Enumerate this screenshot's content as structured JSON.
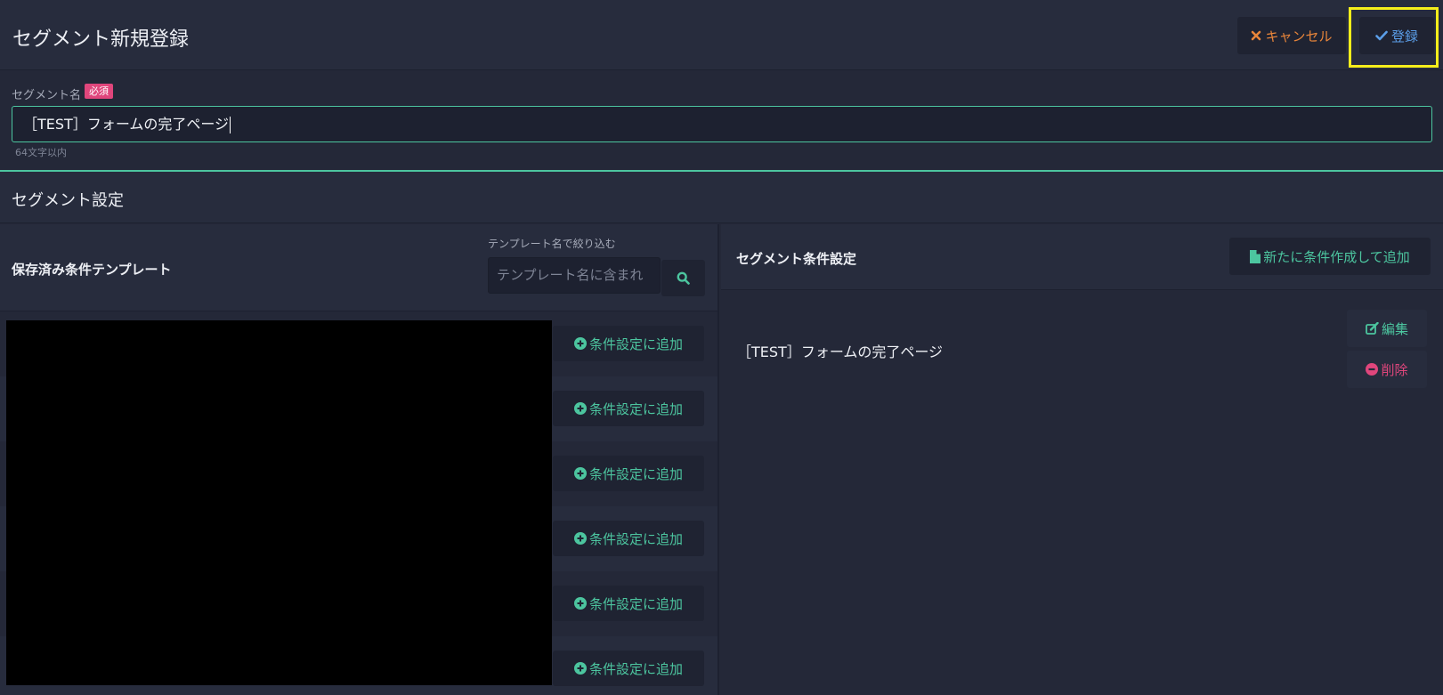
{
  "header": {
    "title": "セグメント新規登録",
    "cancel_label": "キャンセル",
    "register_label": "登録"
  },
  "segment_name": {
    "label": "セグメント名",
    "required_badge": "必須",
    "value": "［TEST］フォームの完了ページ",
    "hint": "64文字以内"
  },
  "segment_settings": {
    "title": "セグメント設定"
  },
  "templates": {
    "title": "保存済み条件テンプレート",
    "filter_label": "テンプレート名で絞り込む",
    "filter_placeholder": "テンプレート名に含まれ",
    "add_buttons": [
      "条件設定に追加",
      "条件設定に追加",
      "条件設定に追加",
      "条件設定に追加",
      "条件設定に追加",
      "条件設定に追加"
    ]
  },
  "conditions": {
    "title": "セグメント条件設定",
    "new_button_label": "新たに条件作成して追加",
    "item_label": "［TEST］フォームの完了ページ",
    "edit_label": "編集",
    "delete_label": "削除"
  },
  "colors": {
    "accent_green": "#4cc59f",
    "cancel_orange": "#e8853a",
    "register_blue": "#5b9ee8",
    "danger_pink": "#e0467c",
    "highlight_yellow": "#f5ee1b"
  }
}
